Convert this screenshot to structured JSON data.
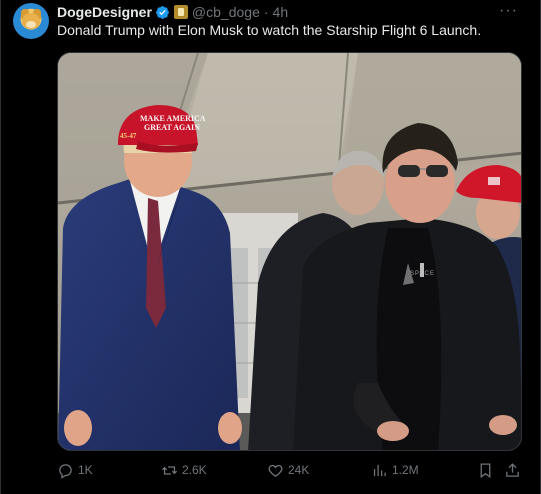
{
  "tweet": {
    "author_name": "DogeDesigner",
    "handle": "@cb_doge",
    "separator": "·",
    "time": "4h",
    "more": "···",
    "text": "Donald Trump with Elon Musk to watch the Starship Flight 6 Launch.",
    "media": {
      "cap_text_top": "MAKE AMERICA",
      "cap_text_bottom": "GREAT AGAIN",
      "cap_side": "45-47",
      "shirt_text": "SPACE"
    }
  },
  "actions": {
    "reply_count": "1K",
    "repost_count": "2.6K",
    "like_count": "24K",
    "views_count": "1.2M"
  },
  "icons": {
    "avatar": "doge-avatar",
    "verified": "verified-badge-icon",
    "affiliate": "affiliate-badge-icon",
    "reply": "reply-icon",
    "repost": "repost-icon",
    "like": "heart-icon",
    "views": "views-icon",
    "bookmark": "bookmark-icon",
    "share": "share-icon"
  },
  "colors": {
    "background": "#000000",
    "text": "#e7e9ea",
    "muted": "#71767b",
    "verified": "#1d9bf0",
    "border": "#2f3336"
  }
}
